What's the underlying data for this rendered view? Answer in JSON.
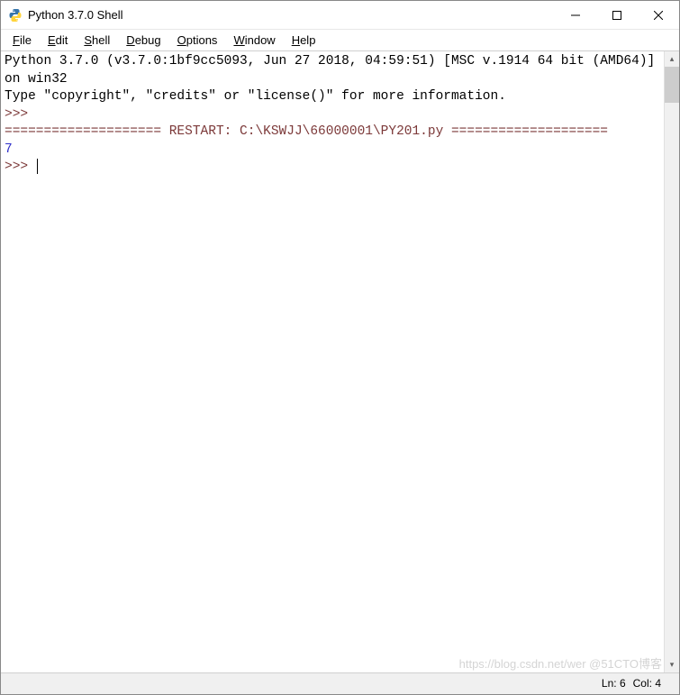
{
  "titlebar": {
    "title": "Python 3.7.0 Shell"
  },
  "menubar": {
    "file": "File",
    "edit": "Edit",
    "shell": "Shell",
    "debug": "Debug",
    "options": "Options",
    "window": "Window",
    "help": "Help"
  },
  "shell": {
    "banner_line1": "Python 3.7.0 (v3.7.0:1bf9cc5093, Jun 27 2018, 04:59:51) [MSC v.1914 64 bit (AMD64)] on win32",
    "banner_line2": "Type \"copyright\", \"credits\" or \"license()\" for more information.",
    "prompt": ">>> ",
    "restart_line": "==================== RESTART: C:\\KSWJJ\\66000001\\PY201.py ====================",
    "output_1": "7"
  },
  "statusbar": {
    "line_label": "Ln:",
    "line_value": "6",
    "col_label": "Col:",
    "col_value": "4"
  },
  "watermark": "https://blog.csdn.net/wer @51CTO博客"
}
